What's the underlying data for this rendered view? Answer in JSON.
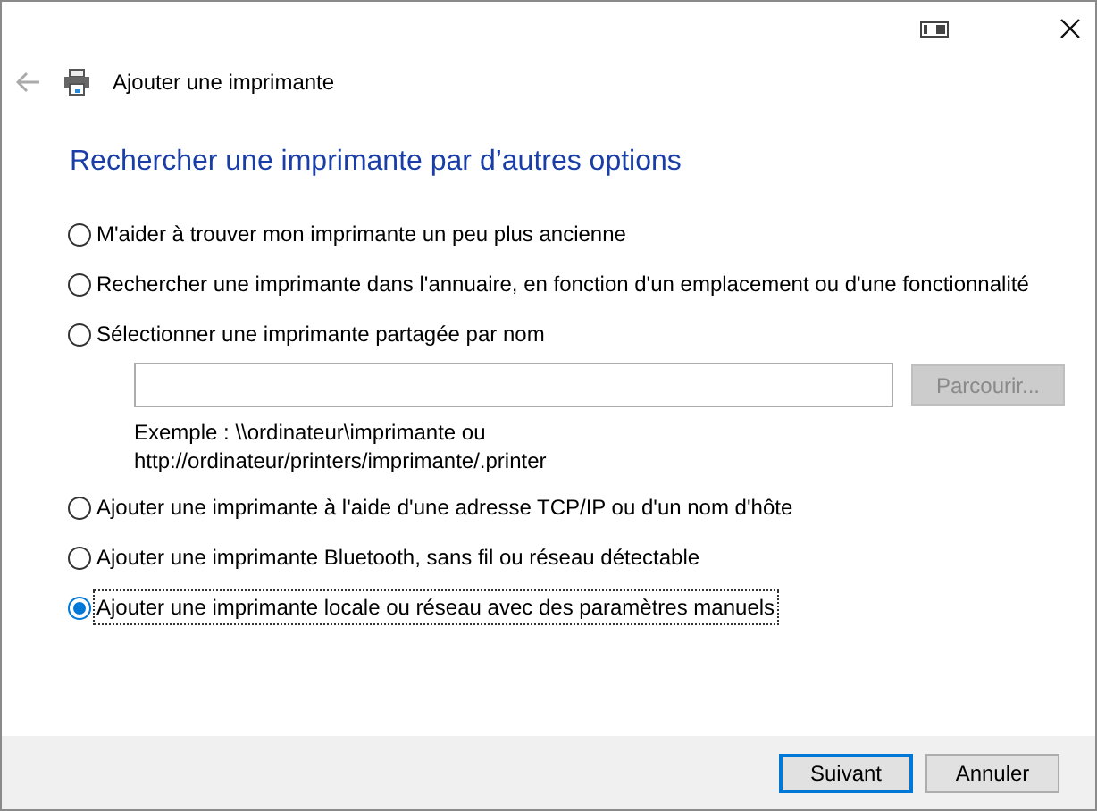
{
  "window": {
    "title": "Ajouter une imprimante"
  },
  "heading": "Rechercher une imprimante par d’autres options",
  "options": [
    {
      "label": "M'aider à trouver mon imprimante un peu plus ancienne",
      "selected": false
    },
    {
      "label": "Rechercher une imprimante dans l'annuaire, en fonction d'un emplacement ou d'une fonctionnalité",
      "selected": false
    },
    {
      "label": "Sélectionner une imprimante partagée par nom",
      "selected": false,
      "share": {
        "browse_button": {
          "label": "Parcourir...",
          "disabled": true
        },
        "example": [
          "Exemple : \\\\ordinateur\\imprimante ou",
          "http://ordinateur/printers/imprimante/.printer"
        ]
      }
    },
    {
      "label": "Ajouter une imprimante à l'aide d'une adresse TCP/IP ou d'un nom d'hôte",
      "selected": false
    },
    {
      "label": "Ajouter une imprimante Bluetooth, sans fil ou réseau détectable",
      "selected": false
    },
    {
      "label": "Ajouter une imprimante locale ou réseau avec des paramètres manuels",
      "selected": true
    }
  ],
  "buttons": [
    {
      "label": "Suivant",
      "default": true
    },
    {
      "label": "Annuler",
      "default": false
    }
  ]
}
